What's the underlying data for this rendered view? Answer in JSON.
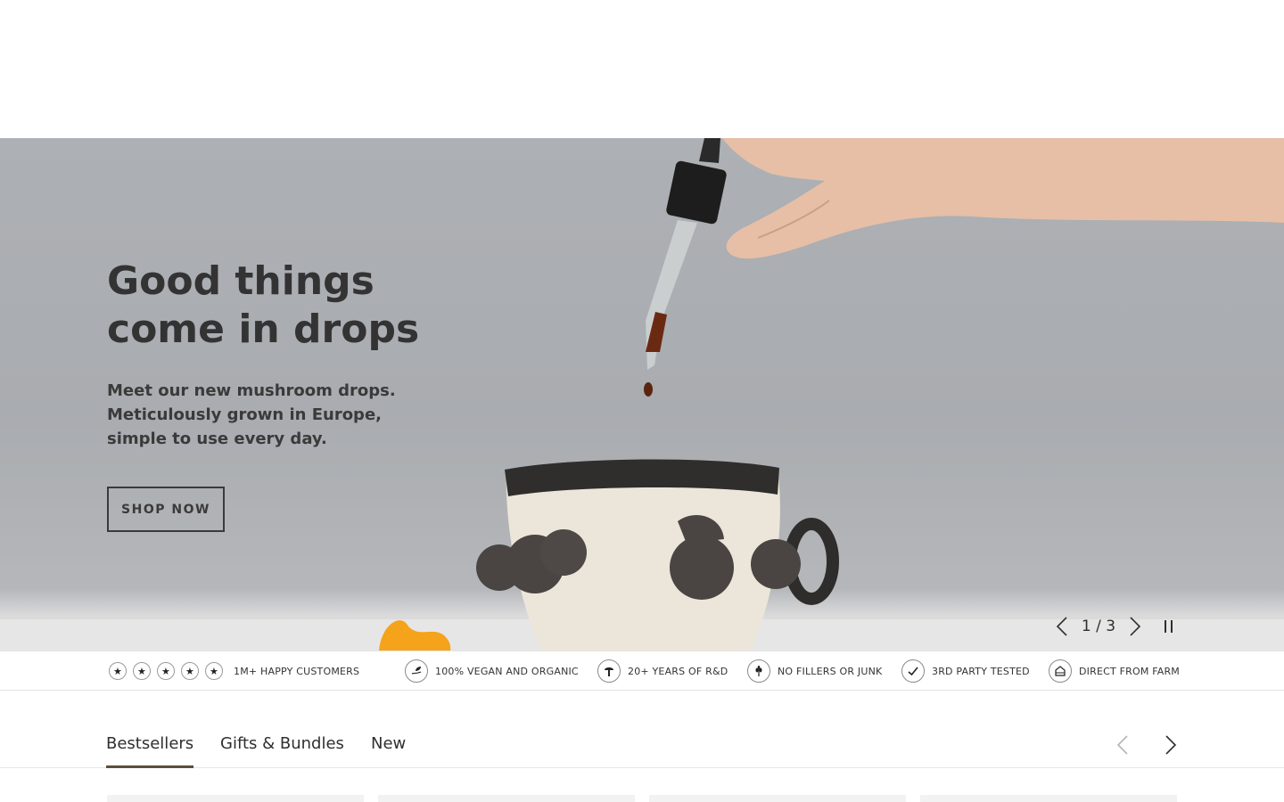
{
  "hero": {
    "title_line1": "Good things",
    "title_line2": "come in drops",
    "sub_line1": "Meet our new mushroom drops.",
    "sub_line2": "Meticulously grown in Europe,",
    "sub_line3": "simple to use every day.",
    "cta_label": "SHOP NOW",
    "slide_counter": "1 / 3"
  },
  "trust": {
    "star_glyph": "★",
    "customers": "1M+ HAPPY CUSTOMERS",
    "vegan": "100% VEGAN AND ORGANIC",
    "rnd": "20+ YEARS OF R&D",
    "fillers": "NO FILLERS OR JUNK",
    "tested": "3RD PARTY TESTED",
    "farm": "DIRECT FROM FARM"
  },
  "products": {
    "tabs": [
      "Bestsellers",
      "Gifts & Bundles",
      "New"
    ],
    "active_tab": "Bestsellers"
  },
  "icons": {
    "hero_prev": "chevron-left-icon",
    "hero_next": "chevron-right-icon",
    "hero_pause": "pause-icon",
    "vegan": "hand-leaf-icon",
    "rnd": "mushroom-icon",
    "fillers": "wheat-icon",
    "tested": "check-icon",
    "farm": "farm-icon"
  },
  "colors": {
    "hero_background": "#adb0b4",
    "text_dark": "#333333",
    "tab_underline": "#5a4e3e"
  }
}
